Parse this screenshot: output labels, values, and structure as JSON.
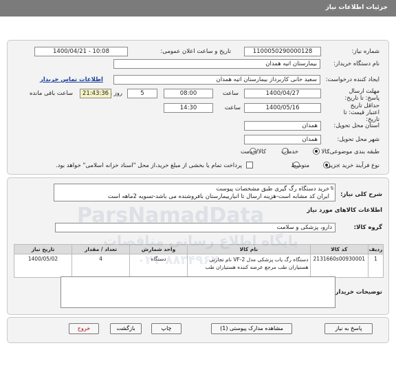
{
  "header": {
    "title": "جزئیات اطلاعات نیاز"
  },
  "info": {
    "need_number_label": "شماره نیاز:",
    "need_number": "1100050290000128",
    "announce_label": "تاریخ و ساعت اعلان عمومی:",
    "announce_value": "1400/04/21 - 10:08",
    "buyer_label": "نام دستگاه خریدار:",
    "buyer_value": "بیمارستان اتیه همدان",
    "creator_label": "ایجاد کننده درخواست:",
    "creator_value": "سعید خانی کاربرداز بیمارستان اتیه همدان",
    "contact_link": "اطلاعات تماس خریدار",
    "deadline_label": "مهلت ارسال پاسخ: تا تاریخ:",
    "deadline_date": "1400/04/27",
    "deadline_time_label": "ساعت",
    "deadline_time": "08:00",
    "days_value": "5",
    "days_label": "روز و",
    "remaining_time": "21:43:36",
    "remaining_label": "ساعت باقی مانده",
    "validity_label": "حداقل تاریخ اعتبار قیمت: تا تاریخ:",
    "validity_date": "1400/05/16",
    "validity_time_label": "ساعت",
    "validity_time": "14:30",
    "province_label": "استان محل تحویل:",
    "province_value": "همدان",
    "city_label": "شهر محل تحویل:",
    "city_value": "همدان",
    "category_label": "طبقه بندی موضوعی:",
    "category_options": [
      "کالا",
      "خدمات",
      "کالا/خدمت"
    ],
    "purchase_label": "نوع فرآیند خرید :",
    "purchase_options": [
      "جزیی",
      "متوسط"
    ],
    "payment_note": "پرداخت تمام یا بخشی از مبلغ خرید،از محل \"اسناد خزانه اسلامی\" خواهد بود."
  },
  "details": {
    "summary_label": "شرح کلی نیاز:",
    "summary_line1": "خرید دستگاه رگ گیری طبق مشخصات پیوست",
    "summary_line2": "ایران کد مشابه است-هزینه ارسال تا انباربیمارستان  بافروشنده می باشد-تسویه 2ماهه است",
    "goods_heading": "اطلاعات کالاهای مورد نیاز",
    "group_label": "گروه کالا:",
    "group_value": "دارو، پزشکی و سلامت",
    "columns": [
      "ردیف",
      "کد کالا",
      "نام کالا",
      "واحد شمارش",
      "تعداد / مقدار",
      "تاریخ نیاز"
    ],
    "rows": [
      {
        "index": "1",
        "code": "2131660s00930001",
        "name": "دستگاه رگ یاب پزشکی مدل VF-2 نام تجارتی هستیاران طب مرجع عرضه کننده هستیاران طب",
        "unit": "دستگاه",
        "qty": "4",
        "date": "1400/05/02"
      }
    ]
  },
  "buyer_notes": {
    "label": "توضیحات خریدار:",
    "value": ""
  },
  "buttons": {
    "reply": "پاسخ به نیاز",
    "attachments": "مشاهده مدارک پیوستی (1)",
    "print": "چاپ",
    "back": "بازگشت",
    "exit": "خروج"
  },
  "watermark": {
    "brand": "ParsNamadData",
    "persian": "پایگاه اطلاع رسانی مناقصات",
    "phone": "۰۲۱-۸۸۳۴۹۶۷۰"
  }
}
